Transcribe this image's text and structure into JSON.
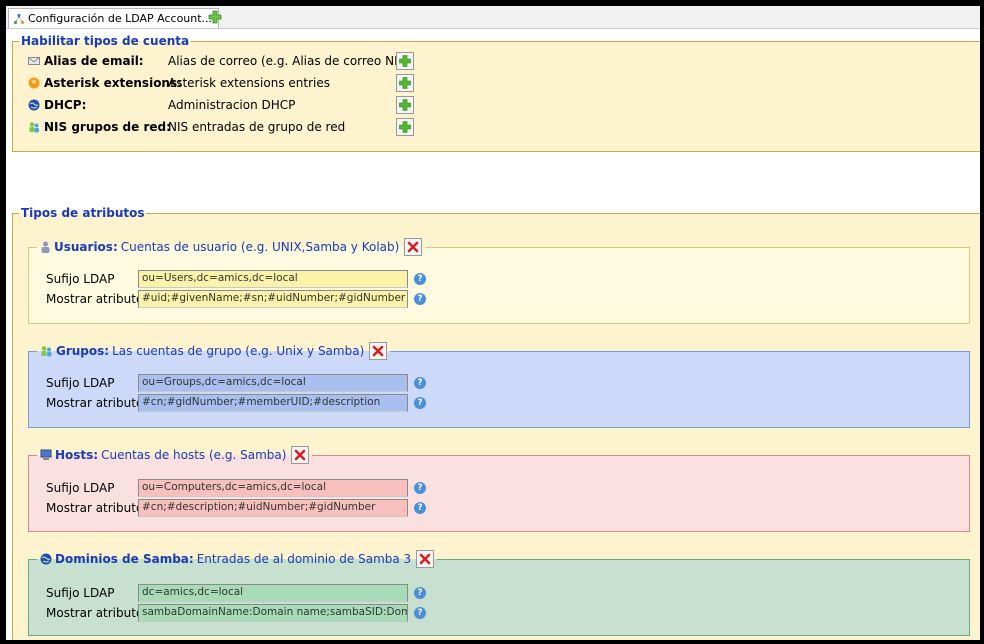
{
  "tab": {
    "title": "Configuración de LDAP Account..."
  },
  "account_types": {
    "legend": "Habilitar tipos de cuenta",
    "items": [
      {
        "name": "Alias de email:",
        "desc": "Alias de correo (e.g. Alias de correo NIS)",
        "icon": "mail-icon"
      },
      {
        "name": "Asterisk extensions:",
        "desc": "Asterisk extensions entries",
        "icon": "asterisk-icon"
      },
      {
        "name": "DHCP:",
        "desc": "Administracion DHCP",
        "icon": "globe-icon"
      },
      {
        "name": "NIS grupos de red:",
        "desc": "NIS entradas de grupo de red",
        "icon": "group-icon"
      }
    ]
  },
  "attr_types": {
    "legend": "Tipos de atributos",
    "sections": [
      {
        "title": "Usuarios:",
        "subtitle": "Cuentas de usuario (e.g. UNIX,Samba y Kolab)",
        "suffix_label": "Sufijo LDAP",
        "suffix_value": "ou=Users,dc=amics,dc=local",
        "attrs_label": "Mostrar atributos",
        "attrs_value": "#uid;#givenName;#sn;#uidNumber;#gidNumber",
        "bg": "#fffbe0",
        "border": "#d8c878",
        "input_bg": "#fcf2a8"
      },
      {
        "title": "Grupos:",
        "subtitle": "Las cuentas de grupo (e.g. Unix y Samba)",
        "suffix_label": "Sufijo LDAP",
        "suffix_value": "ou=Groups,dc=amics,dc=local",
        "attrs_label": "Mostrar atributos",
        "attrs_value": "#cn;#gidNumber;#memberUID;#description",
        "bg": "#ccd9f8",
        "border": "#7d97d8",
        "input_bg": "#a8bff0"
      },
      {
        "title": "Hosts:",
        "subtitle": "Cuentas de hosts (e.g. Samba)",
        "suffix_label": "Sufijo LDAP",
        "suffix_value": "ou=Computers,dc=amics,dc=local",
        "attrs_label": "Mostrar atributos",
        "attrs_value": "#cn;#description;#uidNumber;#gidNumber",
        "bg": "#fbe0e0",
        "border": "#d88a8a",
        "input_bg": "#f8c0bc"
      },
      {
        "title": "Dominios de Samba:",
        "subtitle": "Entradas de al dominio de Samba 3",
        "suffix_label": "Sufijo LDAP",
        "suffix_value": "dc=amics,dc=local",
        "attrs_label": "Mostrar atributos",
        "attrs_value": "sambaDomainName:Domain name;sambaSID:Domain SID",
        "bg": "#c8e0d0",
        "border": "#6aa884",
        "input_bg": "#a8dcb8"
      }
    ]
  }
}
